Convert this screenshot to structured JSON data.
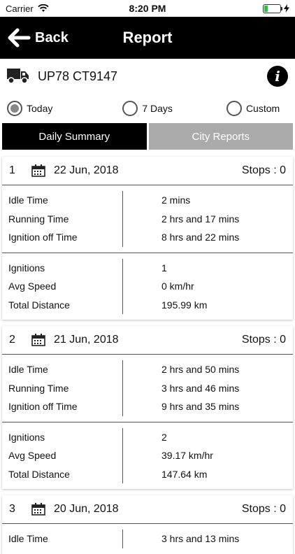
{
  "status": {
    "carrier": "Carrier",
    "time": "8:20 PM"
  },
  "nav": {
    "back_label": "Back",
    "title": "Report"
  },
  "vehicle": {
    "plate": "UP78 CT9147",
    "info_glyph": "i"
  },
  "period": {
    "options": [
      "Today",
      "7 Days",
      "Custom"
    ],
    "selected": "Today"
  },
  "tabs": {
    "daily": "Daily Summary",
    "city": "City Reports"
  },
  "labels": {
    "idle": "Idle Time",
    "running": "Running Time",
    "ignition_off": "Ignition off Time",
    "ignitions": "Ignitions",
    "avg_speed": "Avg Speed",
    "total_distance": "Total Distance"
  },
  "reports": [
    {
      "index": "1",
      "date": "22 Jun, 2018",
      "stops": "Stops : 0",
      "idle": "2 mins",
      "running": "2 hrs and 17 mins",
      "ignition_off": "8 hrs and 22 mins",
      "ignitions": "1",
      "avg_speed": "0 km/hr",
      "total_distance": "195.99 km"
    },
    {
      "index": "2",
      "date": "21 Jun, 2018",
      "stops": "Stops : 0",
      "idle": "2 hrs and 50 mins",
      "running": "3 hrs and 46 mins",
      "ignition_off": "9 hrs and 35 mins",
      "ignitions": "2",
      "avg_speed": "39.17 km/hr",
      "total_distance": "147.64 km"
    },
    {
      "index": "3",
      "date": "20 Jun, 2018",
      "stops": "Stops : 0",
      "idle": "3 hrs and 13 mins"
    }
  ]
}
